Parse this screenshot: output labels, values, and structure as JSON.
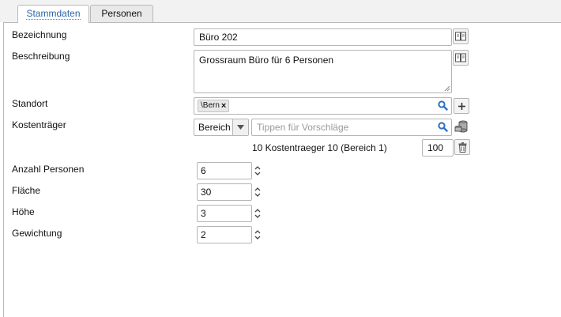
{
  "tabs": [
    {
      "label": "Stammdaten",
      "active": true
    },
    {
      "label": "Personen",
      "active": false
    }
  ],
  "form": {
    "bezeichnung": {
      "label": "Bezeichnung",
      "value": "Büro 202"
    },
    "beschreibung": {
      "label": "Beschreibung",
      "value": "Grossraum Büro für 6 Personen"
    },
    "standort": {
      "label": "Standort",
      "tags": [
        "\\Bern"
      ]
    },
    "kostentraeger": {
      "label": "Kostenträger",
      "type_select": "Bereich",
      "search_placeholder": "Tippen für Vorschläge",
      "entries": [
        {
          "name": "10 Kostentraeger 10 (Bereich 1)",
          "percent": "100"
        }
      ]
    },
    "anzahl_personen": {
      "label": "Anzahl Personen",
      "value": "6"
    },
    "flaeche": {
      "label": "Fläche",
      "value": "30"
    },
    "hoehe": {
      "label": "Höhe",
      "value": "3"
    },
    "gewichtung": {
      "label": "Gewichtung",
      "value": "2"
    }
  },
  "icons": {
    "book": "book-icon",
    "search": "search-icon",
    "plus": "plus-icon",
    "coins": "coins-icon",
    "trash": "trash-icon"
  },
  "colors": {
    "active_tab_text": "#2a64a8",
    "search_icon": "#2b72c2"
  }
}
